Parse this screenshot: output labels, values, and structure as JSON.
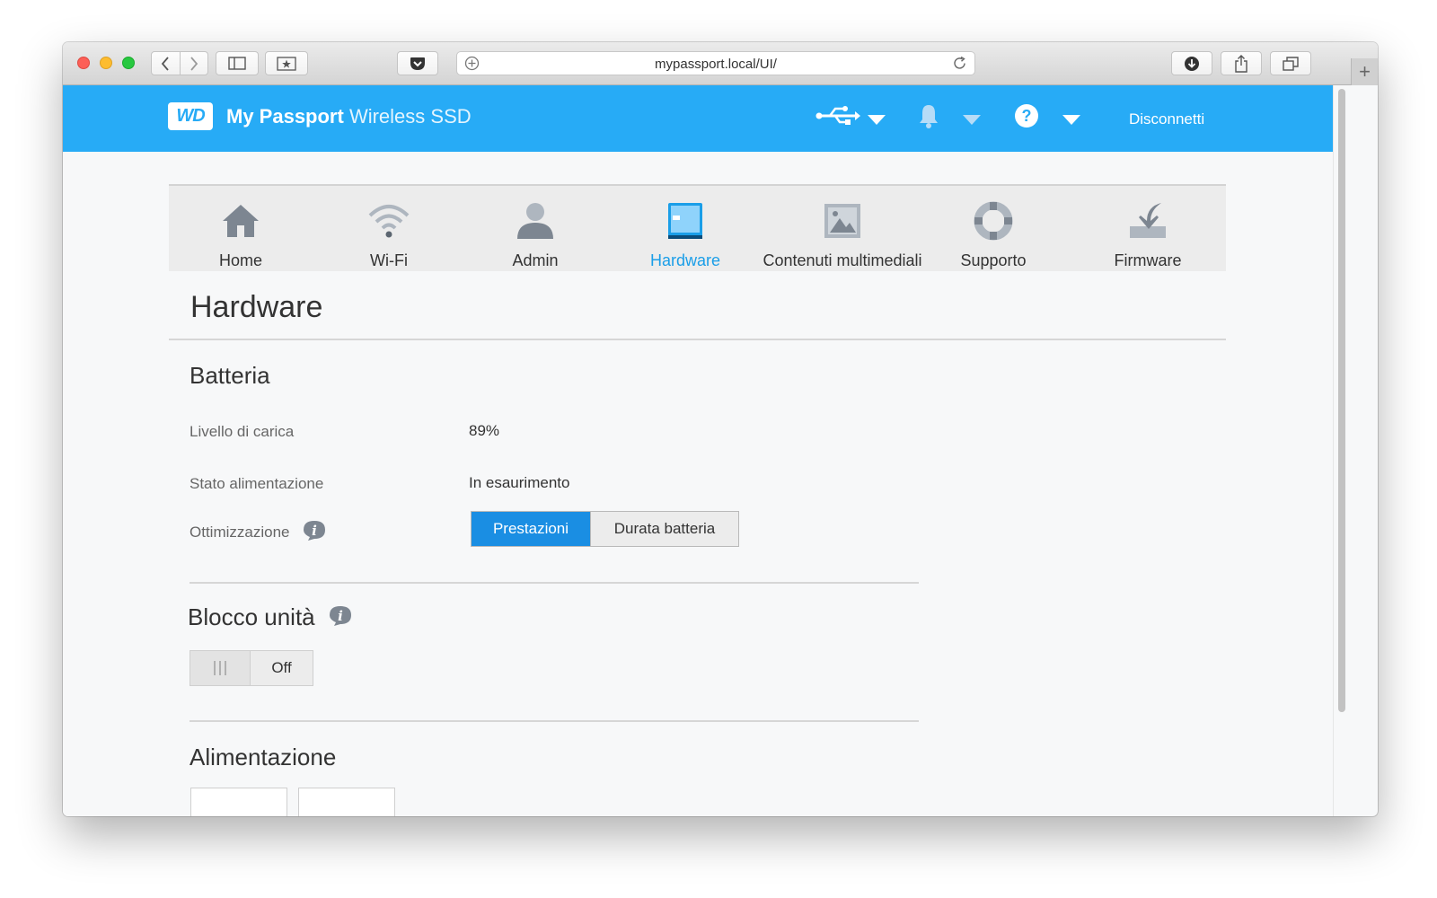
{
  "browser": {
    "url": "mypassport.local/UI/"
  },
  "header": {
    "logo": "WD",
    "title_bold": "My Passport",
    "title_light": "Wireless SSD",
    "disconnect": "Disconnetti"
  },
  "nav": {
    "items": [
      {
        "label": "Home",
        "icon": "home-icon"
      },
      {
        "label": "Wi-Fi",
        "icon": "wifi-icon"
      },
      {
        "label": "Admin",
        "icon": "user-icon"
      },
      {
        "label": "Hardware",
        "icon": "hardware-icon"
      },
      {
        "label": "Contenuti multimediali",
        "icon": "media-icon"
      },
      {
        "label": "Supporto",
        "icon": "lifebuoy-icon"
      },
      {
        "label": "Firmware",
        "icon": "firmware-icon"
      }
    ],
    "active": "Hardware"
  },
  "page": {
    "title": "Hardware"
  },
  "battery": {
    "title": "Batteria",
    "charge_label": "Livello di carica",
    "charge_value": "89%",
    "power_state_label": "Stato alimentazione",
    "power_state_value": "In esaurimento",
    "optimization_label": "Ottimizzazione",
    "optimization_options": [
      "Prestazioni",
      "Durata batteria"
    ],
    "optimization_selected": "Prestazioni"
  },
  "drive_lock": {
    "title": "Blocco unità",
    "state": "Off"
  },
  "power": {
    "title": "Alimentazione"
  },
  "colors": {
    "header_bg": "#27abf6",
    "accent": "#1a8ee3",
    "active_nav": "#1a9ee8"
  }
}
